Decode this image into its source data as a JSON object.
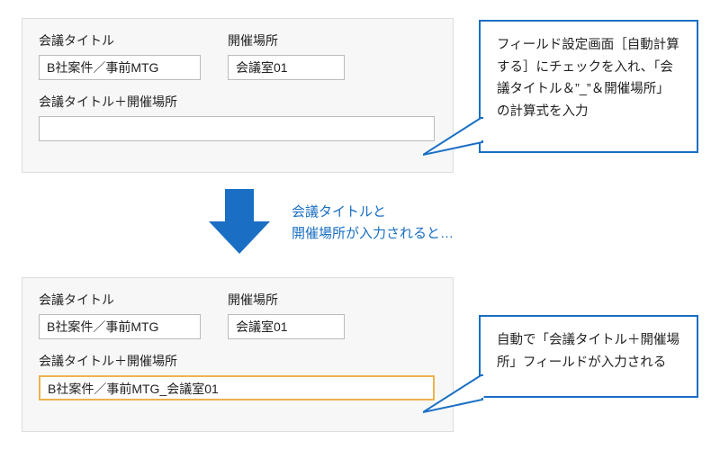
{
  "labels": {
    "meeting_title": "会議タイトル",
    "location": "開催場所",
    "combined": "会議タイトル＋開催場所"
  },
  "before": {
    "meeting_title_value": "B社案件／事前MTG",
    "location_value": "会議室01",
    "combined_value": ""
  },
  "after": {
    "meeting_title_value": "B社案件／事前MTG",
    "location_value": "会議室01",
    "combined_value": "B社案件／事前MTG_会議室01"
  },
  "callouts": {
    "before_text": "フィールド設定画面［自動計算する］にチェックを入れ、「会議タイトル＆”_”＆開催場所」の計算式を入力",
    "after_text": "自動で「会議タイトル＋開催場所」フィールドが入力される"
  },
  "arrow_caption": "会議タイトルと\n開催場所が入力されると…",
  "colors": {
    "accent": "#1a6fc4",
    "highlight": "#eeb24b",
    "panel_bg": "#f7f7f7"
  }
}
